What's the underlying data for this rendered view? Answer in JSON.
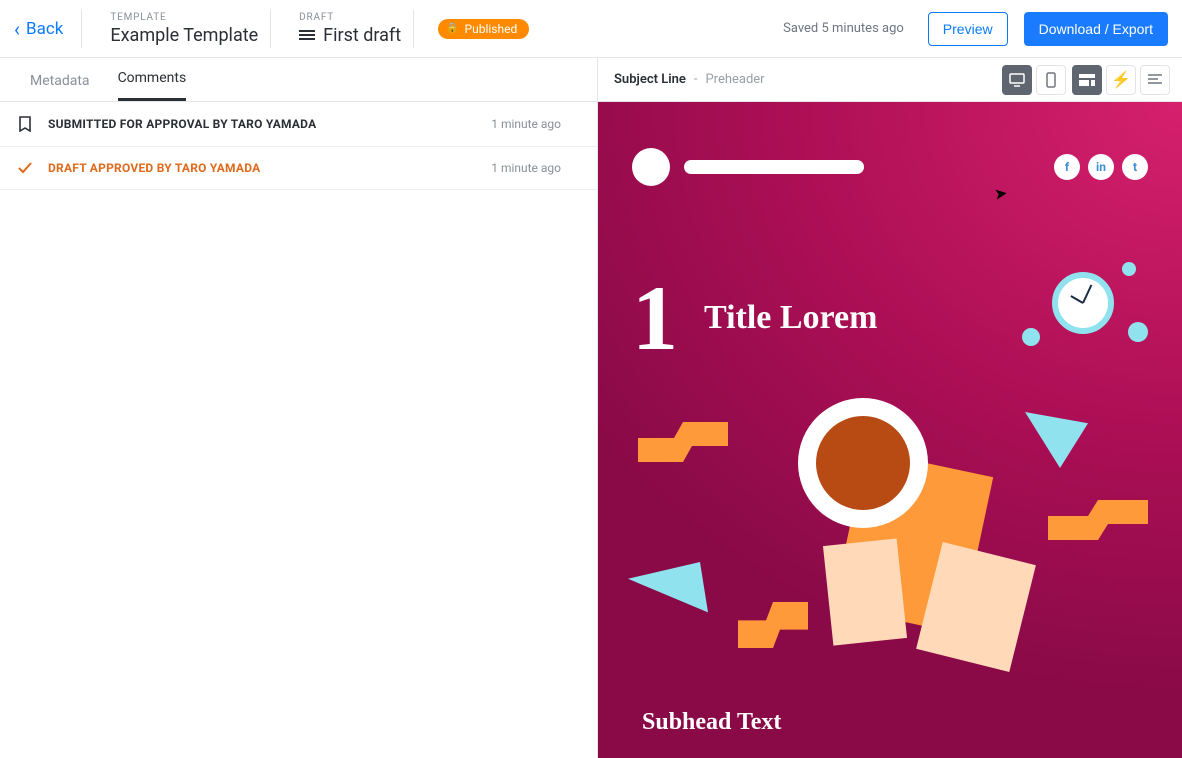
{
  "header": {
    "back": "Back",
    "template_label": "TEMPLATE",
    "template_value": "Example Template",
    "draft_label": "DRAFT",
    "draft_value": "First draft",
    "badge": "Published",
    "saved": "Saved 5 minutes ago",
    "preview": "Preview",
    "download": "Download / Export"
  },
  "tabs": {
    "metadata": "Metadata",
    "comments": "Comments"
  },
  "activity": [
    {
      "icon": "bookmark",
      "text": "SUBMITTED FOR APPROVAL BY TARO YAMADA",
      "time": "1 minute ago",
      "variant": "default"
    },
    {
      "icon": "check",
      "text": "DRAFT APPROVED BY TARO YAMADA",
      "time": "1 minute ago",
      "variant": "approved"
    }
  ],
  "preview_header": {
    "subject_label": "Subject Line",
    "preheader": "Preheader",
    "separator": " - "
  },
  "email": {
    "number": "1",
    "title": "Title Lorem",
    "subhead": "Subhead Text",
    "socials": [
      "f",
      "in",
      "t"
    ]
  }
}
